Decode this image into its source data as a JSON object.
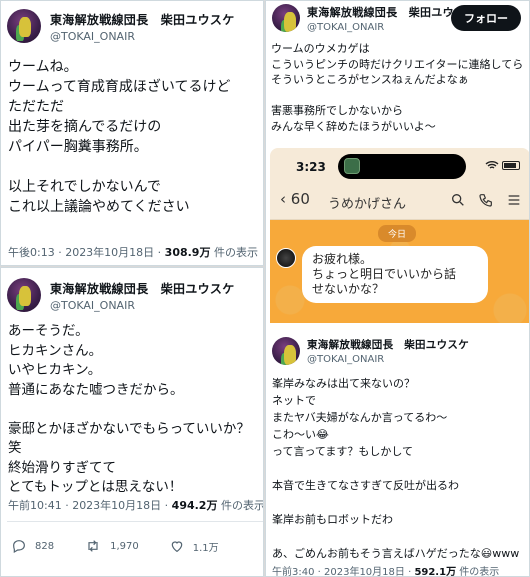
{
  "tweet1": {
    "display_name": "東海解放戦線団長　柴田ユウスケ",
    "handle": "@TOKAI_ONAIR",
    "text": "ウームね。\nウームって育成育成ほざいてるけど\nただただ\n出た芽を摘んでるだけの\nパイパー胸糞事務所。\n\n以上それでしかないんで\nこれ以上議論やめてください",
    "time_date": "午後0:13 · 2023年10月18日 · ",
    "views": "308.9万",
    "views_suffix": " 件の表示"
  },
  "tweet2": {
    "display_name": "東海解放戦線団長　柴田ユウスケ",
    "handle": "@TOKAI_ONAIR",
    "text": "あーそうだ。\nヒカキンさん。\nいやヒカキン。\n普通にあなた嘘つきだから。\n\n豪邸とかほざかないでもらっていいか？笑\n終始滑りすぎてて\nとてもトップとは思えない！",
    "time_date": "午前10:41 · 2023年10月18日 · ",
    "views": "494.2万",
    "views_suffix": " 件の表示",
    "actions": {
      "reply": "828",
      "retweet": "1,970",
      "like": "1.1万"
    }
  },
  "tweet3": {
    "display_name": "東海解放戦線団長　柴田ユウス...",
    "handle": "@TOKAI_ONAIR",
    "follow_label": "フォロー",
    "more_label": "···",
    "text": "ウームのウメカゲは\nこういうピンチの時だけクリエイターに連絡してら\nそういうところがセンスねぇんだよなぁ\n\n害悪事務所でしかないから\nみんな早く辞めたほうがいいよ～",
    "phone": {
      "status_time": "3:23",
      "back_count": "60",
      "chat_name": "うめかげさん",
      "date_pill": "今日",
      "message": "お疲れ様。\nちょっと明日でいいから話\nせないかな？"
    }
  },
  "tweet4": {
    "display_name": "東海解放戦線団長　柴田ユウスケ",
    "handle": "@TOKAI_ONAIR",
    "text": "峯岸みなみは出て来ないの？\nネットで\nまたヤバ夫婦がなんか言ってるわ～\nこわ～い😂\nって言ってます？もしかして\n\n本音で生きてなさすぎて反吐が出るわ\n\n峯岸お前もロボットだわ\n\nあ、ごめんお前もそう言えばハゲだったな😃www",
    "time_date": "午前3:40 · 2023年10月18日 · ",
    "views": "592.1万",
    "views_suffix": " 件の表示"
  }
}
